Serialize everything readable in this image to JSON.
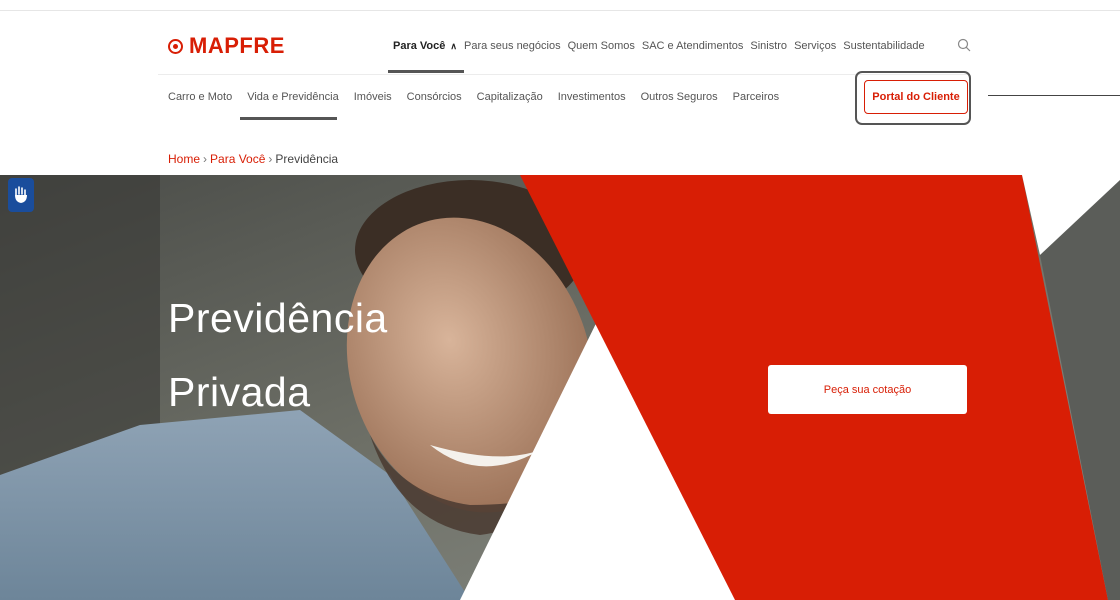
{
  "brand": {
    "logo_text": "MAPFRE",
    "accent": "#d81e05"
  },
  "main_nav": {
    "items": [
      {
        "label": "Para Você",
        "active": true
      },
      {
        "label": "Para seus negócios"
      },
      {
        "label": "Quem Somos"
      },
      {
        "label": "SAC e Atendimentos"
      },
      {
        "label": "Sinistro"
      },
      {
        "label": "Serviços"
      },
      {
        "label": "Sustentabilidade"
      }
    ],
    "search_icon": "search-icon"
  },
  "sub_nav": {
    "items": [
      {
        "label": "Carro e Moto"
      },
      {
        "label": "Vida e Previdência",
        "active": true
      },
      {
        "label": "Imóveis"
      },
      {
        "label": "Consórcios"
      },
      {
        "label": "Capitalização"
      },
      {
        "label": "Investimentos"
      },
      {
        "label": "Outros Seguros"
      },
      {
        "label": "Parceiros"
      }
    ],
    "portal_button": "Portal do Cliente"
  },
  "breadcrumb": {
    "home": "Home",
    "section": "Para Você",
    "current": "Previdência"
  },
  "hero": {
    "title_line1": "Previdência",
    "title_line2": "Privada",
    "cta": "Peça sua cotação"
  },
  "accessibility": {
    "icon": "sign-language-icon",
    "color": "#1a4d9c"
  }
}
